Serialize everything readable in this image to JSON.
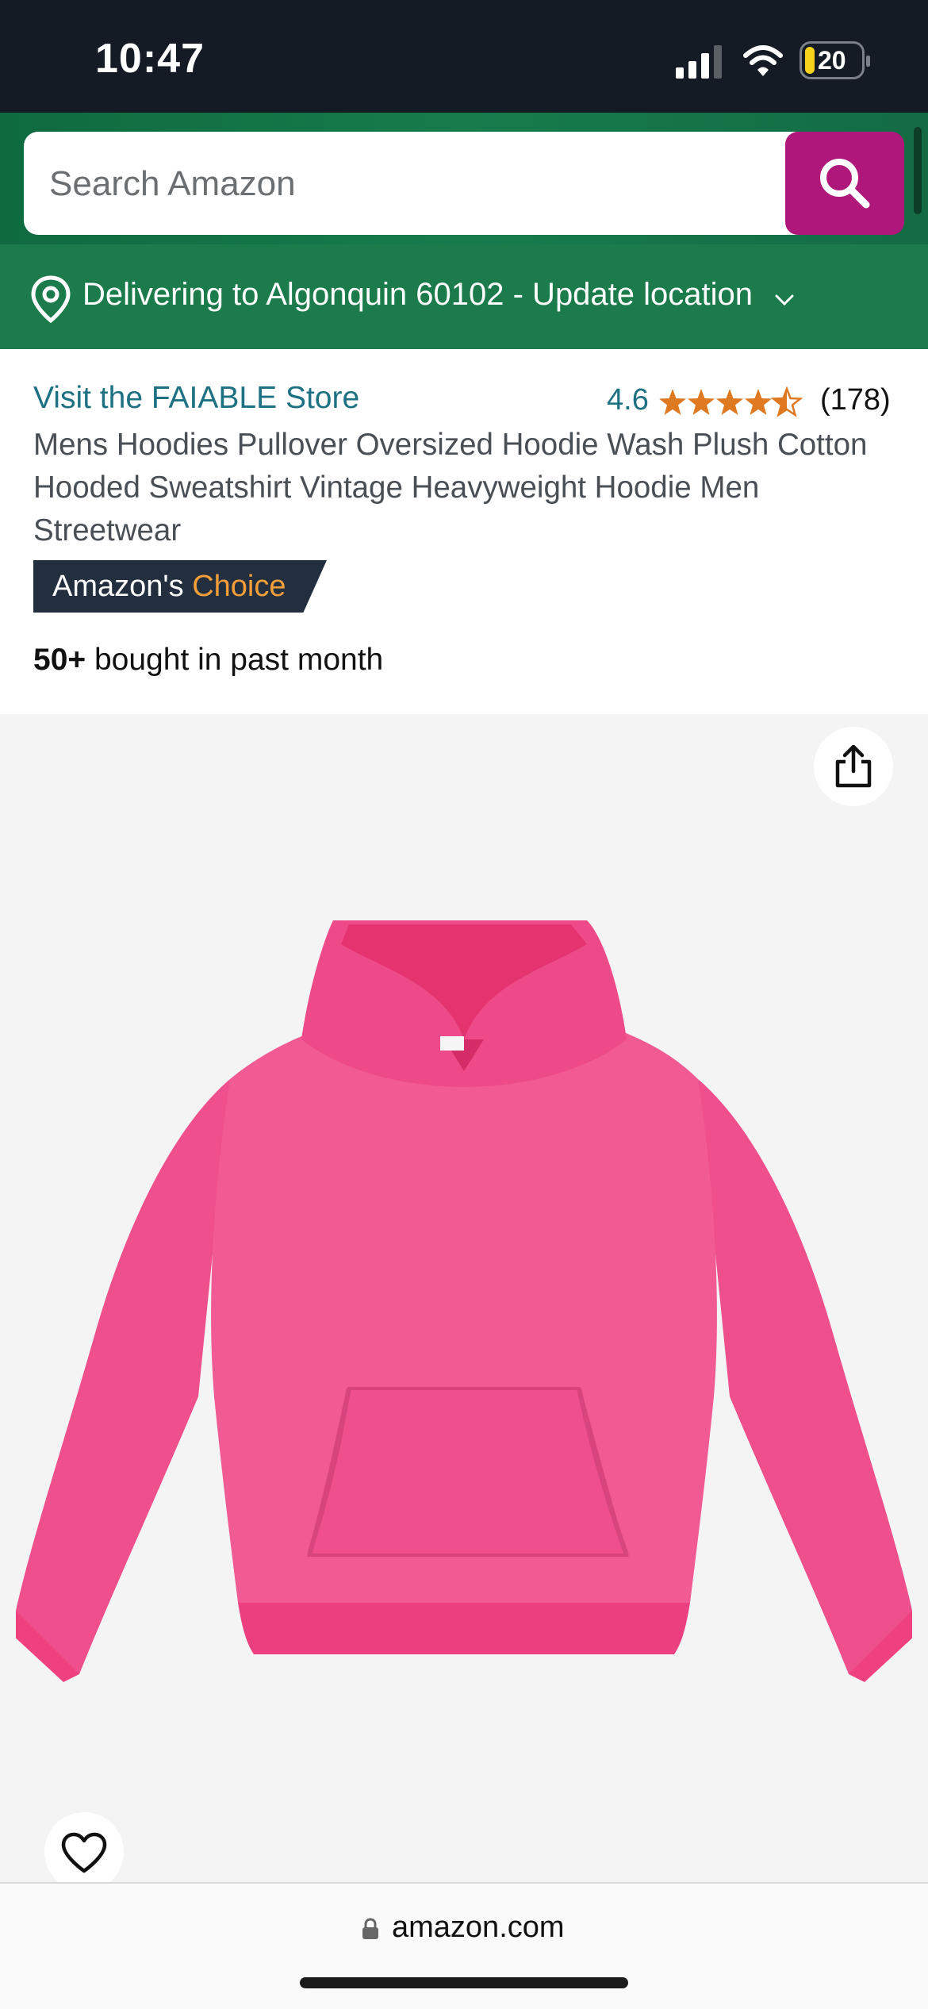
{
  "status_bar": {
    "time": "10:47",
    "battery_level": "20",
    "icons": [
      "signal-icon",
      "wifi-icon",
      "battery-icon"
    ]
  },
  "search": {
    "placeholder": "Search Amazon",
    "button_icon": "search-icon",
    "button_color": "#b0177b"
  },
  "delivery": {
    "text": "Delivering to Algonquin 60102 - Update location",
    "icon": "location-pin-icon"
  },
  "product": {
    "store_link": "Visit the FAIABLE Store",
    "rating": "4.6",
    "rating_stars_fraction": 0.92,
    "review_count": "(178)",
    "title": "Mens Hoodies Pullover Oversized Hoodie Wash Plush Cotton Hooded Sweatshirt Vintage Heavyweight Hoodie Men Streetwear",
    "badge_prefix": "Amazon's ",
    "badge_choice": "Choice",
    "bought_count": "50+",
    "bought_text": " bought in past month"
  },
  "image_area": {
    "share_icon": "share-icon",
    "wishlist_icon": "heart-icon",
    "product_color": "#f0578f"
  },
  "browser": {
    "url": "amazon.com",
    "icon": "lock-icon"
  },
  "colors": {
    "header_green": "#167c4c",
    "delivery_green": "#1b7b4b",
    "link_teal": "#1d7183",
    "star_orange": "#de7921",
    "badge_dark": "#232f3e",
    "badge_orange": "#f49e3a"
  }
}
